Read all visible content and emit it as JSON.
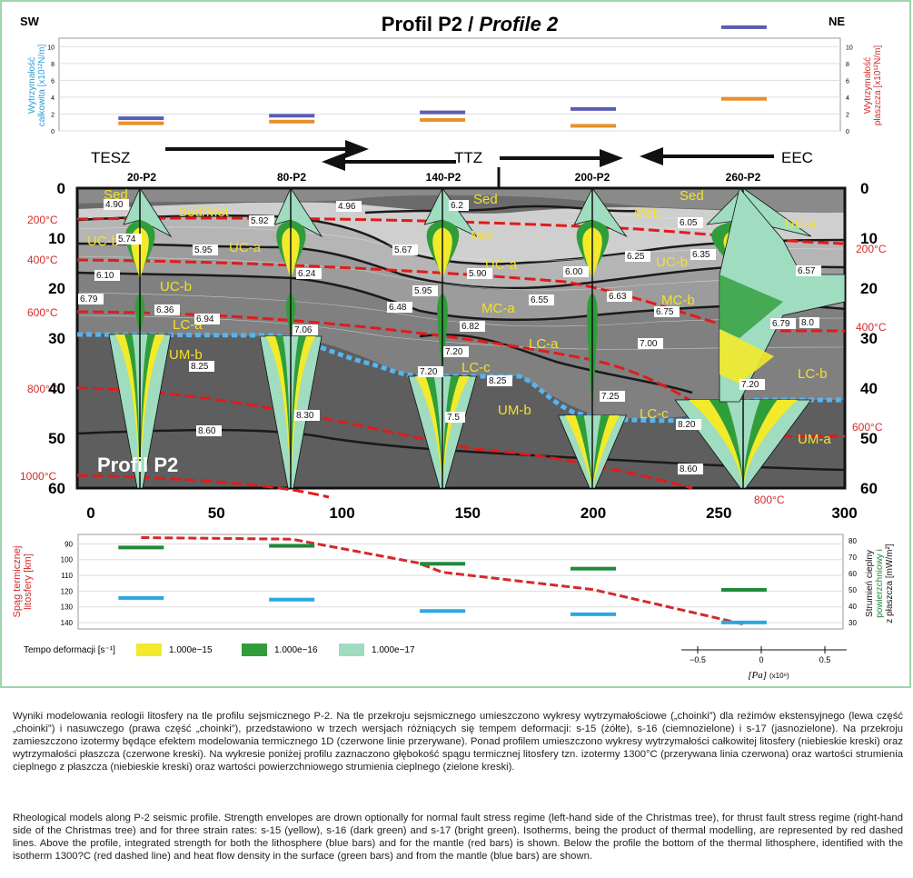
{
  "title": {
    "main": "Profil P2 / ",
    "italic": "Profile 2"
  },
  "dir_left": "SW",
  "dir_right": "NE",
  "strength_chart": {
    "ylabel_left": [
      "Wytrzymałość",
      "całkowita [x10¹²N/m]"
    ],
    "ylabel_right": [
      "Wytrzymałość",
      "płaszcza [x10¹²N/m]"
    ],
    "ticks": [
      "0",
      "2",
      "4",
      "6",
      "8",
      "10"
    ],
    "ylim": [
      0,
      11
    ],
    "total_color": "#5b5fb3",
    "mantle_color": "#e8912a",
    "total_bars": [
      {
        "x": 20,
        "v": 1.5
      },
      {
        "x": 80,
        "v": 1.8
      },
      {
        "x": 140,
        "v": 2.2
      },
      {
        "x": 200,
        "v": 2.6
      },
      {
        "x": 260,
        "v": 12.3
      }
    ],
    "mantle_bars": [
      {
        "x": 20,
        "v": 0.9
      },
      {
        "x": 80,
        "v": 1.1
      },
      {
        "x": 140,
        "v": 1.3
      },
      {
        "x": 200,
        "v": 0.6
      },
      {
        "x": 260,
        "v": 3.8
      }
    ]
  },
  "zones": {
    "tesz": "TESZ",
    "ttz": "TTZ",
    "eec": "EEC"
  },
  "stations": [
    "20-P2",
    "80-P2",
    "140-P2",
    "200-P2",
    "260-P2"
  ],
  "section": {
    "xticks": [
      "0",
      "50",
      "100",
      "150",
      "200",
      "250",
      "300"
    ],
    "yticks": [
      "0",
      "10",
      "20",
      "30",
      "40",
      "50",
      "60"
    ],
    "inset_title": "Profil P2",
    "layer_labels": [
      "Sed",
      "Sed/Met",
      "Sed",
      "Met.",
      "Sed",
      "Met",
      "UC-a",
      "UC-a",
      "UC-b",
      "UC-a",
      "UC-b",
      "UC-b",
      "MC-a",
      "MC-b",
      "LC-a",
      "LC-a",
      "LC-b",
      "LC-c",
      "LC-c",
      "UM-b",
      "UM-b",
      "UM-a"
    ],
    "velocities": [
      "4.90",
      "5.92",
      "4.96",
      "5.74",
      "5.95",
      "6.05",
      "5.67",
      "6.35",
      "6.25",
      "6.10",
      "6.24",
      "6.00",
      "5.90",
      "6.57",
      "6.79",
      "5.95",
      "6.48",
      "6.55",
      "6.63",
      "6.36",
      "6.94",
      "6.75",
      "7.06",
      "6.82",
      "6.79",
      "7.20",
      "7.00",
      "8.25",
      "7.20",
      "8.25",
      "7.25",
      "7.20",
      "8.30",
      "8.60",
      "8.20",
      "8.60",
      "6.2",
      "7.5",
      "8.0"
    ],
    "isotherms_left": [
      "200°C",
      "400°C",
      "600°C",
      "800°C",
      "1000°C"
    ],
    "isotherms_right": [
      "200°C",
      "400°C",
      "600°C",
      "800°C"
    ]
  },
  "lower_chart": {
    "ylabel_left": [
      "Spąg termicznej",
      "litosfery [km]"
    ],
    "ylabel_right": [
      "Strumień cieplny",
      "powierzchniowy i",
      "z płaszcza [mW/m²]"
    ],
    "ticks_left": [
      "90",
      "100",
      "110",
      "120",
      "130",
      "140"
    ],
    "ticks_right": [
      "80",
      "70",
      "60",
      "50",
      "40",
      "30"
    ],
    "lab_depth": [
      {
        "x": 20,
        "v": 86
      },
      {
        "x": 80,
        "v": 87
      },
      {
        "x": 130,
        "v": 102
      },
      {
        "x": 140,
        "v": 108
      },
      {
        "x": 200,
        "v": 119
      },
      {
        "x": 260,
        "v": 141
      }
    ],
    "surface_heat_flow": [
      {
        "x": 20,
        "v": 76
      },
      {
        "x": 80,
        "v": 77
      },
      {
        "x": 140,
        "v": 66
      },
      {
        "x": 200,
        "v": 63
      },
      {
        "x": 260,
        "v": 50
      }
    ],
    "mantle_heat_flow": [
      {
        "x": 20,
        "v": 45
      },
      {
        "x": 80,
        "v": 44
      },
      {
        "x": 140,
        "v": 37
      },
      {
        "x": 200,
        "v": 35
      },
      {
        "x": 260,
        "v": 30
      }
    ],
    "lab_color": "#d42a2a",
    "surface_color": "#1f8a3a",
    "mantle_color": "#2aa9e0"
  },
  "legend": {
    "label": "Tempo deformacji [s⁻¹]",
    "items": [
      {
        "color": "#f2ea2a",
        "label": "1.000e−15"
      },
      {
        "color": "#2f9e3a",
        "label": "1.000e−16"
      },
      {
        "color": "#9fdcc0",
        "label": "1.000e−17"
      }
    ]
  },
  "scale": {
    "ticks": [
      "−0.5",
      "0",
      "0.5"
    ],
    "label": "[Pa]",
    "unit": "(x10⁸)"
  },
  "caption_pl": "Wyniki modelowania reologii litosfery na tle profilu sejsmicznego P-2. Na tle przekroju sejsmicznego umieszczono wykresy wytrzymałościowe („choinki”) dla reżimów ekstensyjnego (lewa część „choinki”) i nasuwczego (prawa część „choinki”), przedstawiono w trzech wersjach różniących się tempem deformacji: s-15 (żółte), s-16 (ciemnozielone) i s-17 (jasnozielone). Na przekroju zamieszczono izotermy będące efektem modelowania termicznego 1D (czerwone linie przerywane). Ponad profilem umieszczono wykresy wytrzymałości całkowitej litosfery (niebieskie kreski) oraz wytrzymałości płaszcza (czerwone kreski). Na wykresie poniżej profilu zaznaczono głębokość spągu termicznej litosfery tzn. izotermy 1300°C (przerywana linia czerwona) oraz wartości strumienia cieplnego z płaszcza (niebieskie kreski) oraz wartości powierzchniowego strumienia cieplnego (zielone kreski).",
  "caption_en": "Rheological models along P-2 seismic profile. Strength envelopes are drown optionally for normal fault stress regime (left-hand side of the Christmas tree), for thrust fault stress regime (right-hand side of the Christmas tree) and for three strain rates: s-15 (yellow), s-16 (dark green) and s-17 (bright green). Isotherms, being the product of thermal modelling, are represented by red dashed lines. Above the profile, integrated strength for both the lithosphere (blue bars) and for the mantle (red bars) is shown. Below the profile the bottom of the thermal lithosphere, identified with the isotherm 1300?C (red dashed line) and heat flow density in the surface (green bars) and from the mantle (blue bars) are shown."
}
